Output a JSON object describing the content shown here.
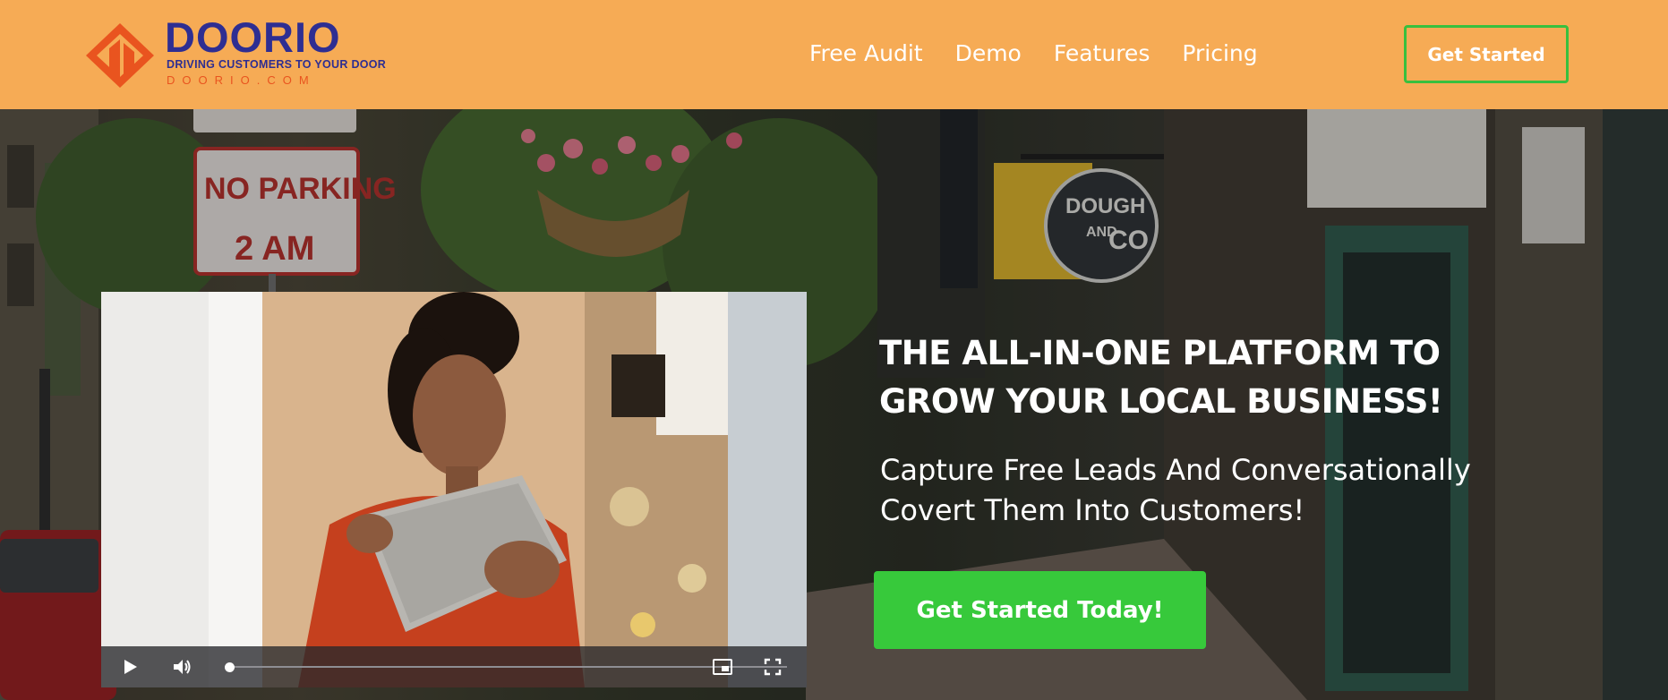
{
  "brand": {
    "name": "DOORIO",
    "tagline": "DRIVING CUSTOMERS TO YOUR DOOR",
    "domain": "DOORIO.COM",
    "logo_icon": "door-diamond-icon",
    "colors": {
      "navy": "#2e2e92",
      "orange": "#e9541f"
    }
  },
  "header": {
    "background": "#f6ab55",
    "nav": [
      {
        "label": "Free Audit"
      },
      {
        "label": "Demo"
      },
      {
        "label": "Features"
      },
      {
        "label": "Pricing"
      }
    ],
    "cta_label": "Get Started",
    "cta_border_color": "#38c03e"
  },
  "hero": {
    "title": "THE ALL-IN-ONE PLATFORM TO GROW YOUR LOCAL BUSINESS!",
    "subtitle": "Capture Free Leads And Conversationally Covert Them Into Customers!",
    "cta_label": "Get Started Today!",
    "cta_color": "#37c93b",
    "background_signs": {
      "parking_sign_1": "NO PARKING",
      "parking_sign_2": "2 AM",
      "shop_sign_1": "DOUGH",
      "shop_sign_2": "AND",
      "shop_sign_3": "CO"
    }
  },
  "video": {
    "progress": 0.0,
    "icons": {
      "play": "play-icon",
      "volume": "volume-icon",
      "pip": "picture-in-picture-icon",
      "fullscreen": "fullscreen-icon"
    }
  }
}
